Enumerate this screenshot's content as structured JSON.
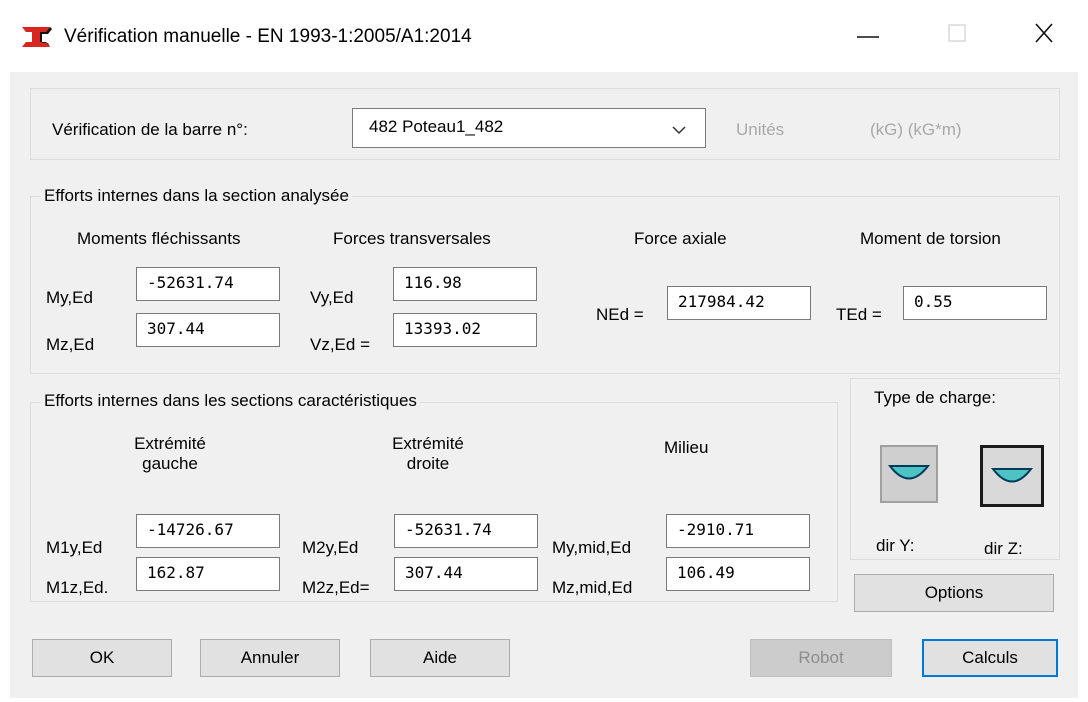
{
  "window": {
    "title": "Vérification manuelle - EN 1993-1:2005/A1:2014",
    "app_icon": "robot-beam-icon",
    "controls": {
      "minimize": "minimize-icon",
      "maximize": "maximize-icon",
      "close": "close-icon"
    }
  },
  "bar": {
    "label": "Vérification de la barre n°:",
    "selected": "482  Poteau1_482",
    "units_label": "Unités",
    "units_value": "(kG) (kG*m)"
  },
  "internal_forces": {
    "title": "Efforts internes dans la section analysée",
    "moments_header": "Moments fléchissants",
    "shear_header": "Forces transversales",
    "axial_header": "Force axiale",
    "torsion_header": "Moment de torsion",
    "my_label": "My,Ed",
    "my_value": "-52631.74",
    "mz_label": "Mz,Ed",
    "mz_value": "307.44",
    "vy_label": "Vy,Ed",
    "vy_value": "116.98",
    "vz_label": "Vz,Ed =",
    "vz_value": "13393.02",
    "ned_label": "NEd =",
    "ned_value": "217984.42",
    "ted_label": "TEd =",
    "ted_value": "0.55"
  },
  "characteristic": {
    "title": "Efforts internes dans les sections caractéristiques",
    "left_header_1": "Extrémité",
    "left_header_2": "gauche",
    "right_header_1": "Extrémité",
    "right_header_2": "droite",
    "mid_header": "Milieu",
    "m1y_label": "M1y,Ed",
    "m1y_value": "-14726.67",
    "m1z_label": "M1z,Ed.",
    "m1z_value": "162.87",
    "m2y_label": "M2y,Ed",
    "m2y_value": "-52631.74",
    "m2z_label": "M2z,Ed=",
    "m2z_value": "307.44",
    "mymid_label": "My,mid,Ed",
    "mymid_value": "-2910.71",
    "mzmid_label": "Mz,mid,Ed",
    "mzmid_value": "106.49"
  },
  "load_type": {
    "title": "Type de charge:",
    "dir_y": "dir Y:",
    "dir_z": "dir Z:",
    "options": "Options"
  },
  "buttons": {
    "ok": "OK",
    "cancel": "Annuler",
    "help": "Aide",
    "robot": "Robot",
    "calc": "Calculs"
  },
  "colors": {
    "accent": "#0078d7",
    "curve": "#4dc3c3",
    "dialog_bg": "#f0f0f0"
  }
}
